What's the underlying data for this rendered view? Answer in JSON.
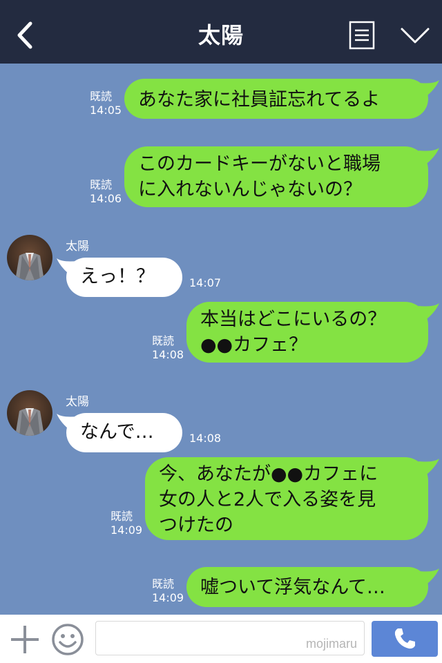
{
  "header": {
    "title": "太陽"
  },
  "messages": [
    {
      "dir": "out",
      "text": "あなた家に社員証忘れてるよ",
      "read": "既読",
      "time": "14:05"
    },
    {
      "dir": "out",
      "text": "このカードキーがないと職場\nに入れないんじゃないの？",
      "read": "既読",
      "time": "14:06"
    },
    {
      "dir": "in",
      "sender": "太陽",
      "text": "えっ！？",
      "time": "14:07"
    },
    {
      "dir": "out",
      "text": "本当はどこにいるの？\n●●カフェ？",
      "read": "既読",
      "time": "14:08"
    },
    {
      "dir": "in",
      "sender": "太陽",
      "text": "なんで…",
      "time": "14:08"
    },
    {
      "dir": "out",
      "text": "今、あなたが●●カフェに\n女の人と2人で入る姿を見\nつけたの",
      "read": "既読",
      "time": "14:09"
    },
    {
      "dir": "out",
      "text": "嘘ついて浮気なんて…",
      "read": "既読",
      "time": "14:09"
    }
  ],
  "footer": {
    "input_value": "",
    "watermark": "mojimaru"
  },
  "colors": {
    "header": "#232b40",
    "background": "#6f8fbf",
    "outgoing": "#84e243",
    "incoming": "#ffffff",
    "send": "#5c86d6"
  }
}
